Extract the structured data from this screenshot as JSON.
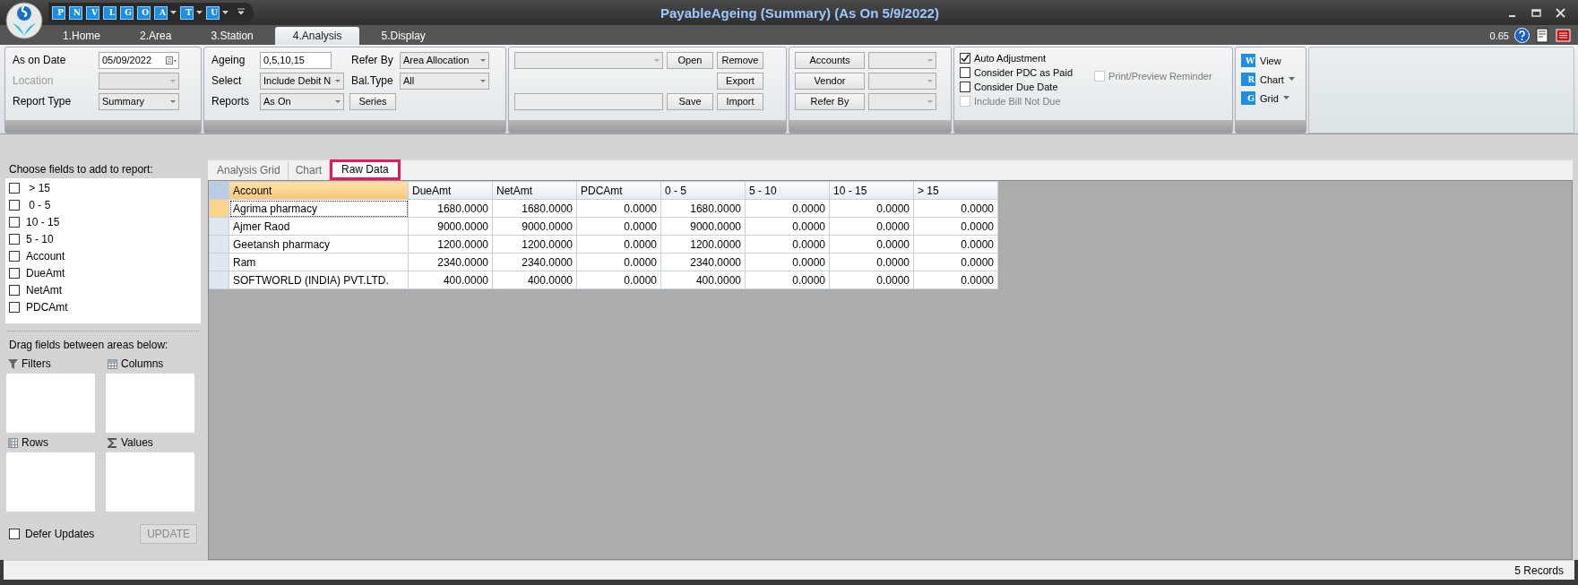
{
  "window": {
    "title": "PayableAgeing (Summary) (As On 5/9/2022)"
  },
  "quick_access": [
    {
      "letter": "P",
      "dropdown": false
    },
    {
      "letter": "N",
      "dropdown": false
    },
    {
      "letter": "V",
      "dropdown": false
    },
    {
      "letter": "L",
      "dropdown": false
    },
    {
      "letter": "G",
      "dropdown": false
    },
    {
      "letter": "O",
      "dropdown": false
    },
    {
      "letter": "A",
      "dropdown": true
    },
    {
      "letter": "T",
      "dropdown": true
    },
    {
      "letter": "U",
      "dropdown": true
    }
  ],
  "menu_tabs": [
    {
      "label": "1.Home",
      "selected": false
    },
    {
      "label": "2.Area",
      "selected": false
    },
    {
      "label": "3.Station",
      "selected": false
    },
    {
      "label": "4.Analysis",
      "selected": true
    },
    {
      "label": "5.Display",
      "selected": false
    }
  ],
  "zoom_reading": "0.65",
  "ribbon": {
    "general": [
      {
        "label": "As on Date",
        "kind": "date",
        "value": "05/09/2022",
        "disabled": false
      },
      {
        "label": "Location",
        "kind": "combo",
        "disabled": true
      },
      {
        "label": "Report Type",
        "kind": "combo",
        "value": "Summary",
        "disabled": false
      }
    ],
    "ageing_left": [
      {
        "label": "Ageing",
        "kind": "text",
        "value": "0,5,10,15"
      },
      {
        "label": "Select",
        "kind": "combo",
        "value": "Include Debit N"
      },
      {
        "label": "Reports",
        "kind": "combo",
        "value": "As On"
      }
    ],
    "ageing_right": [
      {
        "label": "Refer By",
        "kind": "combo",
        "value": "Area Allocation"
      },
      {
        "label": "Bal.Type",
        "kind": "combo",
        "value": "All"
      },
      {
        "kind": "button",
        "value": "Series"
      }
    ],
    "layout": {
      "open": "Open",
      "remove": "Remove",
      "export": "Export",
      "save": "Save",
      "import": "Import"
    },
    "filters": [
      {
        "button": "Accounts"
      },
      {
        "button": "Vendor"
      },
      {
        "button": "Refer By"
      }
    ],
    "options": [
      {
        "label": "Auto Adjustment",
        "checked": true,
        "disabled": false
      },
      {
        "label": "Consider PDC as Paid",
        "checked": false,
        "disabled": false
      },
      {
        "label": "Consider Due Date",
        "checked": false,
        "disabled": false
      },
      {
        "label": "Include Bill Not Due",
        "checked": false,
        "disabled": true
      }
    ],
    "reminder": {
      "label": "Print/Preview Reminder",
      "checked": false,
      "disabled": true
    },
    "view_buttons": [
      {
        "letter": "W",
        "label": "View",
        "dropdown": false
      },
      {
        "letter": "R",
        "label": "Chart",
        "dropdown": true
      },
      {
        "letter": "G",
        "label": "Grid",
        "dropdown": true
      }
    ]
  },
  "field_list": {
    "heading": "Choose fields to add to report:",
    "fields": [
      {
        "label": " > 15",
        "checked": false
      },
      {
        "label": " 0 - 5",
        "checked": false
      },
      {
        "label": "10 - 15",
        "checked": false
      },
      {
        "label": "5 - 10",
        "checked": false
      },
      {
        "label": "Account",
        "checked": false
      },
      {
        "label": "DueAmt",
        "checked": false
      },
      {
        "label": "NetAmt",
        "checked": false
      },
      {
        "label": "PDCAmt",
        "checked": false
      }
    ],
    "drag_heading": "Drag fields between areas below:",
    "areas": [
      {
        "kind": "filter",
        "label": "Filters"
      },
      {
        "kind": "columns",
        "label": "Columns"
      },
      {
        "kind": "rows",
        "label": "Rows"
      },
      {
        "kind": "values",
        "label": "Values"
      }
    ],
    "defer": {
      "label": "Defer Updates",
      "checked": false
    },
    "update_button": {
      "label": "UPDATE",
      "disabled": true
    }
  },
  "content_tabs": [
    {
      "label": "Analysis Grid",
      "selected": false
    },
    {
      "label": "Chart",
      "selected": false
    },
    {
      "label": "Raw Data",
      "selected": true
    }
  ],
  "table": {
    "columns": [
      "Account",
      "DueAmt",
      "NetAmt",
      "PDCAmt",
      "0 - 5",
      "5 - 10",
      "10 - 15",
      "> 15"
    ],
    "rows": [
      {
        "selected": true,
        "cells": [
          "Agrima pharmacy",
          "1680.0000",
          "1680.0000",
          "0.0000",
          "1680.0000",
          "0.0000",
          "0.0000",
          "0.0000"
        ]
      },
      {
        "selected": false,
        "cells": [
          "Ajmer Raod",
          "9000.0000",
          "9000.0000",
          "0.0000",
          "9000.0000",
          "0.0000",
          "0.0000",
          "0.0000"
        ]
      },
      {
        "selected": false,
        "cells": [
          "Geetansh pharmacy",
          "1200.0000",
          "1200.0000",
          "0.0000",
          "1200.0000",
          "0.0000",
          "0.0000",
          "0.0000"
        ]
      },
      {
        "selected": false,
        "cells": [
          "Ram",
          "2340.0000",
          "2340.0000",
          "0.0000",
          "2340.0000",
          "0.0000",
          "0.0000",
          "0.0000"
        ]
      },
      {
        "selected": false,
        "cells": [
          "SOFTWORLD (INDIA) PVT.LTD.",
          "400.0000",
          "400.0000",
          "0.0000",
          "400.0000",
          "0.0000",
          "0.0000",
          "0.0000"
        ]
      }
    ]
  },
  "status_bar": {
    "records": "5 Records"
  }
}
